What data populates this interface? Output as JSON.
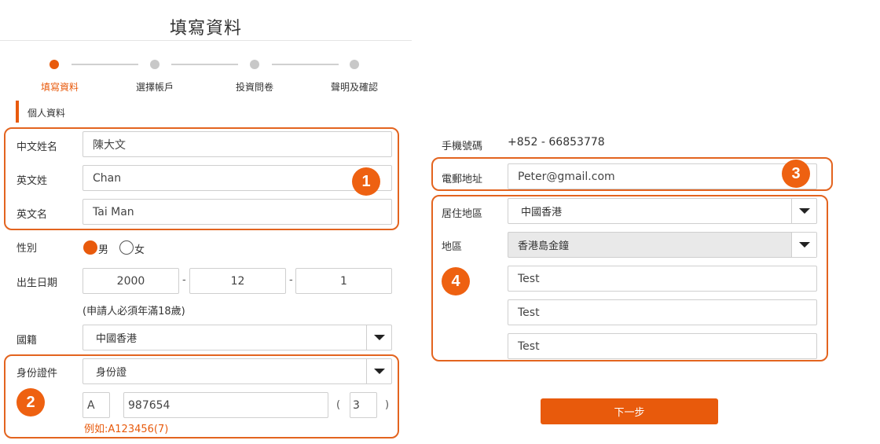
{
  "header": {
    "title": "填寫資料"
  },
  "stepper": {
    "steps": [
      {
        "label": "填寫資料",
        "active": true
      },
      {
        "label": "選擇帳戶",
        "active": false
      },
      {
        "label": "投資問卷",
        "active": false
      },
      {
        "label": "聲明及確認",
        "active": false
      }
    ]
  },
  "section": {
    "title": "個人資料"
  },
  "personal": {
    "chinese_name": {
      "label": "中文姓名",
      "value": "陳大文"
    },
    "english_surname": {
      "label": "英文姓",
      "value": "Chan"
    },
    "english_given": {
      "label": "英文名",
      "value": "Tai Man"
    },
    "gender": {
      "label": "性別",
      "options": [
        "男",
        "女"
      ],
      "selected": "男"
    },
    "dob": {
      "label": "出生日期",
      "year": "2000",
      "sep": "-",
      "month": "12",
      "day": "1"
    },
    "age_note": "(申請人必須年滿18歲)",
    "nationality": {
      "label": "國籍",
      "value": "中國香港"
    },
    "id_doc": {
      "label": "身份證件",
      "type": "身份證",
      "prefix": "A",
      "number": "987654",
      "open_paren": "(",
      "check_digit": "3",
      "close_paren": ")",
      "example": "例如:A123456(7)"
    }
  },
  "contact": {
    "mobile": {
      "label": "手機號碼",
      "value": "+852 - 66853778"
    },
    "email": {
      "label": "電郵地址",
      "value": "Peter@gmail.com"
    },
    "residence": {
      "label": "居住地區",
      "value": "中國香港"
    },
    "district": {
      "label": "地區",
      "value": "香港島金鐘"
    },
    "address_lines": [
      "Test",
      "Test",
      "Test"
    ]
  },
  "badges": [
    "1",
    "2",
    "3",
    "4"
  ],
  "actions": {
    "next_label": "下一步"
  },
  "colors": {
    "accent": "#e85a0c",
    "highlight_border": "#e3641f"
  }
}
